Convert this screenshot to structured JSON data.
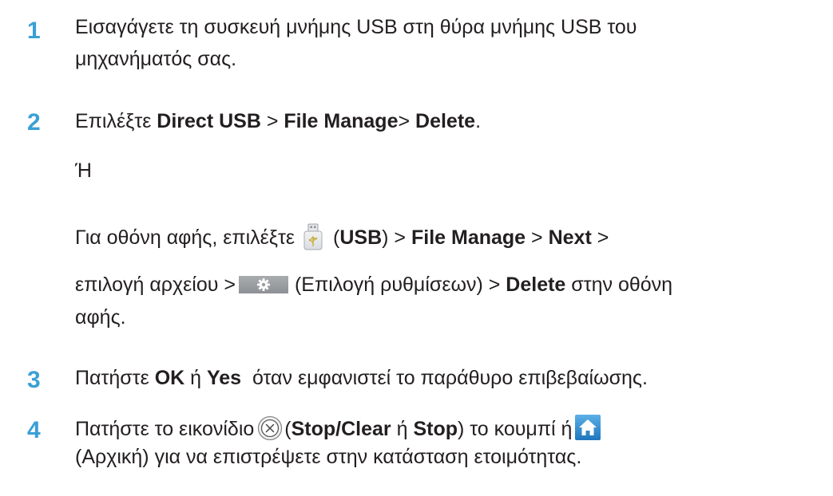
{
  "steps": [
    {
      "number": "1",
      "line1": "Εισαγάγετε τη συσκευή μνήμης USB στη θύρα μνήμης USB του",
      "line2": "μηχανήματός σας."
    },
    {
      "number": "2",
      "pre": "Επιλέξτε ",
      "direct_usb": "Direct USB",
      "sep1": " > ",
      "file_manage": "File Manage",
      "sep2": "> ",
      "delete": "Delete",
      "end": ".",
      "or": "Ή",
      "touch_pre": "Για οθόνη αφής, επιλέξτε",
      "usb_open": "(",
      "usb_label": "USB",
      "usb_close": ") > ",
      "file_manage2": "File Manage",
      "sep3": " > ",
      "next": "Next",
      "sep4": " >",
      "line_b_pre": "επιλογή αρχείου >",
      "settings_text": "(Επιλογή ρυθμίσεων) > ",
      "delete2": "Delete",
      "line_b_post": " στην οθόνη",
      "line_c": "αφής."
    },
    {
      "number": "3",
      "pre": "Πατήστε ",
      "ok": "OK",
      "mid": " ή ",
      "yes": "Yes",
      "post": "  όταν εμφανιστεί το παράθυρο επιβεβαίωσης."
    },
    {
      "number": "4",
      "pre": "Πατήστε το εικονίδιο",
      "open": "(",
      "stop_clear": "Stop/Clear",
      "mid": " ή ",
      "stop": "Stop",
      "post": ") το κουμπί ή",
      "line2": "(Αρχική) για να επιστρέψετε στην κατάσταση ετοιμότητας."
    }
  ],
  "icons": {
    "usb": "usb-icon",
    "settings": "settings-gear-icon",
    "stop": "stop-clear-icon",
    "home": "home-icon"
  },
  "colors": {
    "step_number": "#3aa0d6",
    "text": "#231f20"
  }
}
